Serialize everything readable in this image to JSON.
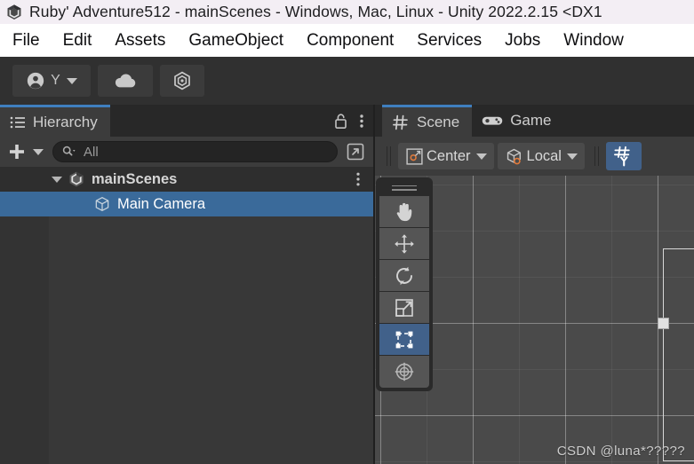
{
  "window": {
    "title": "Ruby' Adventure512 - mainScenes - Windows, Mac, Linux - Unity 2022.2.15 <DX1",
    "icon": "unity-logo-icon"
  },
  "menubar": {
    "items": [
      {
        "label": "File"
      },
      {
        "label": "Edit"
      },
      {
        "label": "Assets"
      },
      {
        "label": "GameObject"
      },
      {
        "label": "Component"
      },
      {
        "label": "Services"
      },
      {
        "label": "Jobs"
      },
      {
        "label": "Window"
      }
    ]
  },
  "main_toolbar": {
    "account": {
      "icon": "account-icon",
      "letter": "Y",
      "dropdown_icon": "chevron-down-icon"
    },
    "cloud": {
      "icon": "cloud-icon"
    },
    "settings": {
      "icon": "unity-hex-icon"
    }
  },
  "hierarchy": {
    "tab": {
      "label": "Hierarchy",
      "icon": "hierarchy-list-icon"
    },
    "lock_icon": "unlocked-padlock-icon",
    "menu_icon": "kebab-menu-icon",
    "add_button": {
      "icon": "plus-icon",
      "dropdown_icon": "chevron-down-icon"
    },
    "search": {
      "placeholder": "All",
      "icon": "search-dropdown-icon"
    },
    "expand_button": {
      "icon": "expand-window-icon"
    },
    "tree": [
      {
        "label": "mainScenes",
        "icon": "unity-scene-icon",
        "expanded": true,
        "selected": false,
        "depth": 0,
        "kebab_icon": "kebab-menu-icon"
      },
      {
        "label": "Main Camera",
        "icon": "gameobject-cube-icon",
        "expanded": false,
        "selected": true,
        "depth": 1
      }
    ]
  },
  "scene_panel": {
    "tabs": [
      {
        "label": "Scene",
        "icon": "scene-grid-icon",
        "active": true
      },
      {
        "label": "Game",
        "icon": "gamepad-icon",
        "active": false
      }
    ],
    "toolbar": {
      "pivot_mode": {
        "label": "Center",
        "icon": "pivot-center-icon",
        "dropdown_icon": "chevron-down-icon"
      },
      "handle_space": {
        "label": "Local",
        "icon": "handle-local-icon",
        "dropdown_icon": "chevron-down-icon"
      },
      "grid_axis_toggle": {
        "icon": "grid-y-axis-icon",
        "active": true,
        "axis_label": "Y"
      }
    },
    "tool_palette": [
      {
        "name": "hand-tool",
        "icon": "hand-icon",
        "active": false
      },
      {
        "name": "move-tool",
        "icon": "move-arrows-icon",
        "active": false
      },
      {
        "name": "rotate-tool",
        "icon": "rotate-icon",
        "active": false
      },
      {
        "name": "scale-tool",
        "icon": "scale-icon",
        "active": false
      },
      {
        "name": "rect-transform-tool",
        "icon": "rect-transform-icon",
        "active": true
      },
      {
        "name": "transform-tool",
        "icon": "transform-combined-icon",
        "active": false
      }
    ],
    "viewport": {
      "watermark": "CSDN @luna*?????",
      "camera_gizmo": "camera-frustum-rect"
    }
  },
  "colors": {
    "accent_blue": "#3f7fbf",
    "selection_blue": "#3a6a9a",
    "tool_active_blue": "#41618a",
    "panel_bg": "#383838",
    "viewport_bg": "#4a4a4a",
    "titlebar_bg": "#f3eef4",
    "menubar_bg": "#ffffff"
  }
}
